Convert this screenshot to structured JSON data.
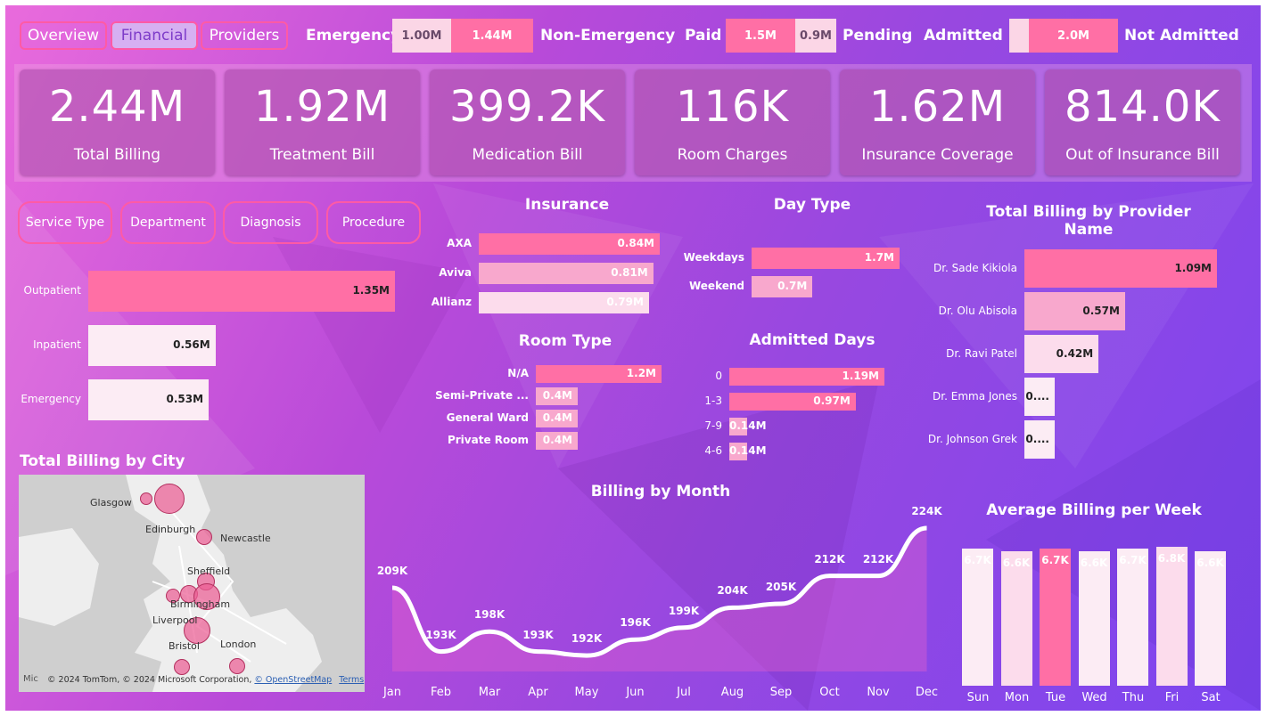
{
  "nav": {
    "overview": "Overview",
    "financial": "Financial",
    "providers": "Providers"
  },
  "filters": {
    "emergency_label": "Emergency",
    "emergency_value": "1.00M",
    "non_emergency_value": "1.44M",
    "non_emergency_label": "Non-Emergency",
    "paid_label": "Paid",
    "paid_value": "1.5M",
    "pending_value": "0.9M",
    "pending_label": "Pending",
    "admitted_label": "Admitted",
    "not_admitted_value": "2.0M",
    "not_admitted_label": "Not Admitted"
  },
  "kpis": [
    {
      "value": "2.44M",
      "label": "Total Billing"
    },
    {
      "value": "1.92M",
      "label": "Treatment Bill"
    },
    {
      "value": "399.2K",
      "label": "Medication Bill"
    },
    {
      "value": "116K",
      "label": "Room Charges"
    },
    {
      "value": "1.62M",
      "label": "Insurance Coverage"
    },
    {
      "value": "814.0K",
      "label": "Out of Insurance Bill"
    }
  ],
  "filter_buttons": {
    "service_type": "Service Type",
    "department": "Department",
    "diagnosis": "Diagnosis",
    "procedure": "Procedure"
  },
  "colors": {
    "bar_dark": "#ff6fa5",
    "bar_mid": "#f8a8cd",
    "bar_light": "#fcdcec",
    "bar_pale": "#fcecf4",
    "accent_border": "#ff5aa5"
  },
  "map": {
    "title": "Total Billing by City",
    "cities": [
      "Glasgow",
      "Edinburgh",
      "Newcastle",
      "Sheffield",
      "Birmingham",
      "Liverpool",
      "Bristol",
      "London"
    ],
    "credit": "© 2024 TomTom, © 2024 Microsoft Corporation,",
    "osm": "© OpenStreetMap",
    "terms": "Terms",
    "ms": "Mic"
  },
  "chart_data": [
    {
      "type": "bar",
      "title": "",
      "categories": [
        "Outpatient",
        "Inpatient",
        "Emergency"
      ],
      "values": [
        1.35,
        0.56,
        0.53
      ],
      "labels": [
        "1.35M",
        "0.56M",
        "0.53M"
      ],
      "unit": "M"
    },
    {
      "type": "bar",
      "title": "Insurance",
      "categories": [
        "AXA",
        "Aviva",
        "Allianz"
      ],
      "values": [
        0.84,
        0.81,
        0.79
      ],
      "labels": [
        "0.84M",
        "0.81M",
        "0.79M"
      ],
      "unit": "M"
    },
    {
      "type": "bar",
      "title": "Day Type",
      "categories": [
        "Weekdays",
        "Weekend"
      ],
      "values": [
        1.7,
        0.7
      ],
      "labels": [
        "1.7M",
        "0.7M"
      ],
      "unit": "M"
    },
    {
      "type": "bar",
      "title": "Total Billing by Provider Name",
      "categories": [
        "Dr. Sade Kikiola",
        "Dr. Olu Abisola",
        "Dr. Ravi Patel",
        "Dr. Emma Jones",
        "Dr. Johnson Grek"
      ],
      "values": [
        1.09,
        0.57,
        0.42,
        0.08,
        0.08
      ],
      "labels": [
        "1.09M",
        "0.57M",
        "0.42M",
        "0....",
        "0...."
      ],
      "unit": "M"
    },
    {
      "type": "bar",
      "title": "Room Type",
      "categories": [
        "N/A",
        "Semi-Private ...",
        "General Ward",
        "Private Room"
      ],
      "values": [
        1.2,
        0.4,
        0.4,
        0.4
      ],
      "labels": [
        "1.2M",
        "0.4M",
        "0.4M",
        "0.4M"
      ],
      "unit": "M"
    },
    {
      "type": "bar",
      "title": "Admitted Days",
      "categories": [
        "0",
        "1-3",
        "7-9",
        "4-6"
      ],
      "values": [
        1.19,
        0.97,
        0.14,
        0.14
      ],
      "labels": [
        "1.19M",
        "0.97M",
        "0.14M",
        "0.14M"
      ],
      "unit": "M"
    },
    {
      "type": "area",
      "title": "Billing by Month",
      "categories": [
        "Jan",
        "Feb",
        "Mar",
        "Apr",
        "May",
        "Jun",
        "Jul",
        "Aug",
        "Sep",
        "Oct",
        "Nov",
        "Dec"
      ],
      "values": [
        209,
        193,
        198,
        193,
        192,
        196,
        199,
        204,
        205,
        212,
        212,
        224
      ],
      "labels": [
        "209K",
        "193K",
        "198K",
        "193K",
        "192K",
        "196K",
        "199K",
        "204K",
        "205K",
        "212K",
        "212K",
        "224K"
      ],
      "unit": "K"
    },
    {
      "type": "bar",
      "title": "Average Billing per Week",
      "categories": [
        "Sun",
        "Mon",
        "Tue",
        "Wed",
        "Thu",
        "Fri",
        "Sat"
      ],
      "values": [
        6.7,
        6.6,
        6.7,
        6.6,
        6.7,
        6.8,
        6.6
      ],
      "labels": [
        "6.7K",
        "6.6K",
        "6.7K",
        "6.6K",
        "6.7K",
        "6.8K",
        "6.6K"
      ],
      "unit": "K"
    }
  ]
}
